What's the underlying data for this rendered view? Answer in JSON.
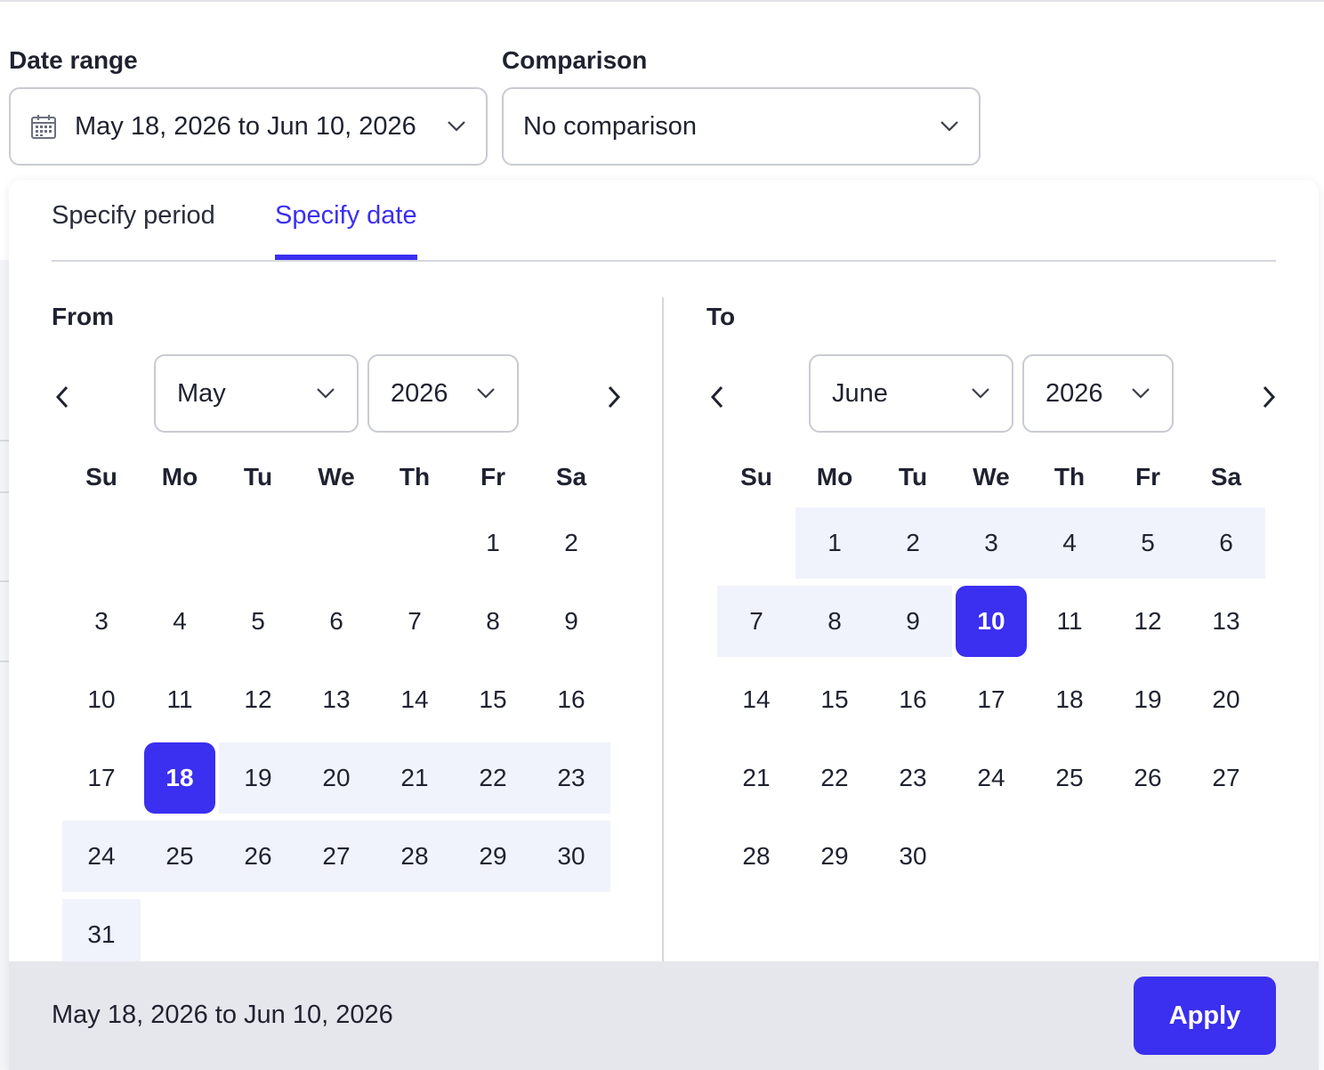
{
  "date_range": {
    "label": "Date range",
    "value": "May 18, 2026 to Jun 10, 2026"
  },
  "comparison": {
    "label": "Comparison",
    "value": "No comparison"
  },
  "tabs": [
    {
      "label": "Specify period",
      "active": false
    },
    {
      "label": "Specify date",
      "active": true
    }
  ],
  "weekdays": [
    "Su",
    "Mo",
    "Tu",
    "We",
    "Th",
    "Fr",
    "Sa"
  ],
  "from": {
    "title": "From",
    "month": "May",
    "year": "2026",
    "first_weekday": 5,
    "days_in_month": 31,
    "selected": 18,
    "range_start": 18,
    "range_end": 31
  },
  "to": {
    "title": "To",
    "month": "June",
    "year": "2026",
    "first_weekday": 1,
    "days_in_month": 30,
    "selected": 10,
    "range_start": 1,
    "range_end": 10
  },
  "footer": {
    "summary": "May 18, 2026 to Jun 10, 2026",
    "apply_label": "Apply"
  },
  "colors": {
    "accent": "#3b2ff0",
    "range_fill": "#f0f3fc",
    "footer_bg": "#e6e7ec"
  }
}
